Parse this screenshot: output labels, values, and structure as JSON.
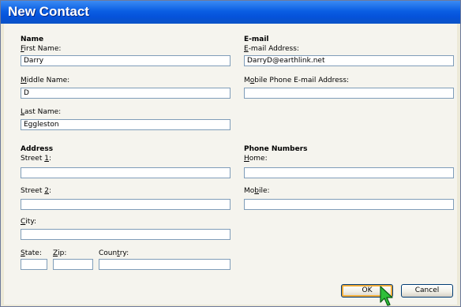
{
  "window": {
    "title": "New Contact"
  },
  "name": {
    "section": "Name",
    "first_label": "First Name:",
    "first_value": "Darry",
    "middle_label": "Middle Name:",
    "middle_value": "D",
    "last_label": "Last Name:",
    "last_value": "Eggleston"
  },
  "email": {
    "section": "E-mail",
    "address_label": "E-mail Address:",
    "address_value": "DarryD@earthlink.net",
    "mobile_label": "Mobile Phone E-mail Address:",
    "mobile_value": ""
  },
  "address": {
    "section": "Address",
    "street1_label": "Street 1:",
    "street1_value": "",
    "street2_label": "Street 2:",
    "street2_value": "",
    "city_label": "City:",
    "city_value": "",
    "state_label": "State:",
    "state_value": "",
    "zip_label": "Zip:",
    "zip_value": "",
    "country_label": "Country:",
    "country_value": ""
  },
  "phone": {
    "section": "Phone Numbers",
    "home_label": "Home:",
    "home_value": "",
    "mobile_label": "Mobile:",
    "mobile_value": ""
  },
  "buttons": {
    "ok": "OK",
    "cancel": "Cancel"
  },
  "colors": {
    "titlebar": "#0a5ee3",
    "dialog_bg": "#f5f4ee",
    "cursor": "#2fbf3a"
  },
  "icons": {
    "cursor": "arrow-cursor-icon"
  }
}
